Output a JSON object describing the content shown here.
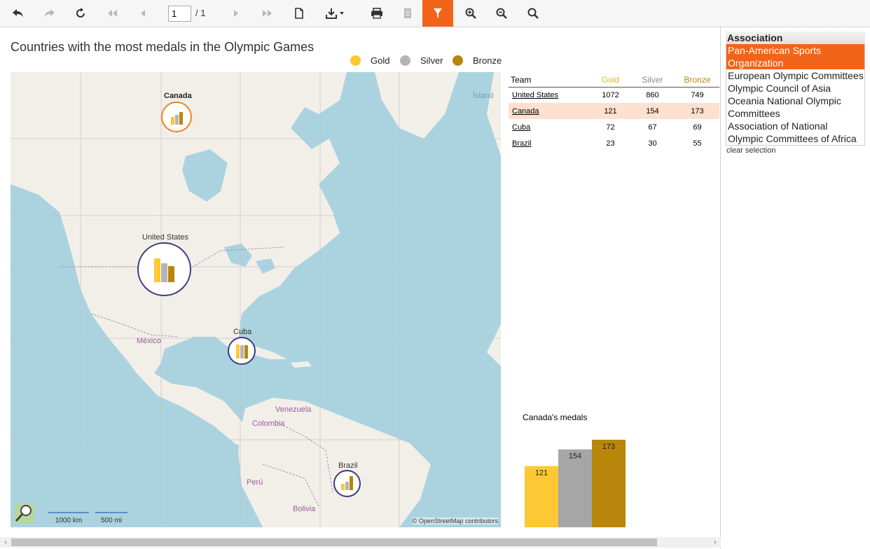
{
  "toolbar": {
    "page_input": "1",
    "page_total": "/ 1",
    "buttons": [
      {
        "name": "back-button",
        "icon": "undo-arrow-icon",
        "state": "enabled"
      },
      {
        "name": "forward-button",
        "icon": "redo-arrow-icon",
        "state": "disabled"
      },
      {
        "name": "refresh-button",
        "icon": "refresh-icon",
        "state": "enabled"
      },
      {
        "name": "first-page-button",
        "icon": "double-chevron-left-icon",
        "state": "disabled"
      },
      {
        "name": "previous-page-button",
        "icon": "chevron-left-icon",
        "state": "disabled"
      },
      {
        "name": "next-page-button",
        "icon": "chevron-right-icon",
        "state": "disabled"
      },
      {
        "name": "last-page-button",
        "icon": "double-chevron-right-icon",
        "state": "disabled"
      },
      {
        "name": "document-map-button",
        "icon": "document-icon",
        "state": "enabled"
      },
      {
        "name": "export-button",
        "icon": "download-icon",
        "state": "enabled"
      },
      {
        "name": "print-button",
        "icon": "printer-icon",
        "state": "enabled"
      },
      {
        "name": "print-preview-button",
        "icon": "page-icon",
        "state": "disabled"
      },
      {
        "name": "filter-button",
        "icon": "filter-icon",
        "state": "active"
      },
      {
        "name": "zoom-in-button",
        "icon": "zoom-in-icon",
        "state": "enabled"
      },
      {
        "name": "zoom-out-button",
        "icon": "zoom-out-icon",
        "state": "enabled"
      },
      {
        "name": "zoom-button",
        "icon": "magnifier-icon",
        "state": "enabled"
      }
    ]
  },
  "report": {
    "title": "Countries with the most medals in the Olympic Games",
    "legend": [
      {
        "label": "Gold",
        "color": "#fcc934"
      },
      {
        "label": "Silver",
        "color": "#b5b5b5"
      },
      {
        "label": "Bronze",
        "color": "#b8860b"
      }
    ]
  },
  "map": {
    "markers": [
      {
        "name": "Canada",
        "selected": true
      },
      {
        "name": "United States",
        "selected": false
      },
      {
        "name": "Cuba",
        "selected": false
      },
      {
        "name": "Brazil",
        "selected": false
      }
    ],
    "country_labels": [
      "México",
      "Venezuela",
      "Colombia",
      "Perú",
      "Bolivia"
    ],
    "other_labels": [
      "Ísland"
    ],
    "scale_km": "1000 km",
    "scale_mi": "500 mi",
    "attribution": "© OpenStreetMap contributors"
  },
  "table": {
    "headers": {
      "team": "Team",
      "gold": "Gold",
      "silver": "Silver",
      "bronze": "Bronze"
    },
    "header_colors": {
      "gold": "#e8b321",
      "silver": "#8a8a8a",
      "bronze": "#b8860b"
    },
    "rows": [
      {
        "team": "United States",
        "gold": "1072",
        "silver": "860",
        "bronze": "749",
        "selected": false
      },
      {
        "team": "Canada",
        "gold": "121",
        "silver": "154",
        "bronze": "173",
        "selected": true
      },
      {
        "team": "Cuba",
        "gold": "72",
        "silver": "67",
        "bronze": "69",
        "selected": false
      },
      {
        "team": "Brazil",
        "gold": "23",
        "silver": "30",
        "bronze": "55",
        "selected": false
      }
    ]
  },
  "chart_data": {
    "type": "bar",
    "title": "Canada's medals",
    "categories": [
      "Gold",
      "Silver",
      "Bronze"
    ],
    "values": [
      121,
      154,
      173
    ],
    "colors": [
      "#fcc934",
      "#a6a6a6",
      "#b8860b"
    ],
    "ylim": [
      0,
      173
    ]
  },
  "panel": {
    "header": "Association",
    "items": [
      {
        "label": "Pan-American Sports Organization",
        "selected": true
      },
      {
        "label": "European Olympic Committees",
        "selected": false
      },
      {
        "label": "Olympic Council of Asia",
        "selected": false
      },
      {
        "label": "Oceania National Olympic Committees",
        "selected": false
      },
      {
        "label": "Association of National Olympic Committees of Africa",
        "selected": false
      }
    ],
    "clear_label": "clear selection"
  }
}
